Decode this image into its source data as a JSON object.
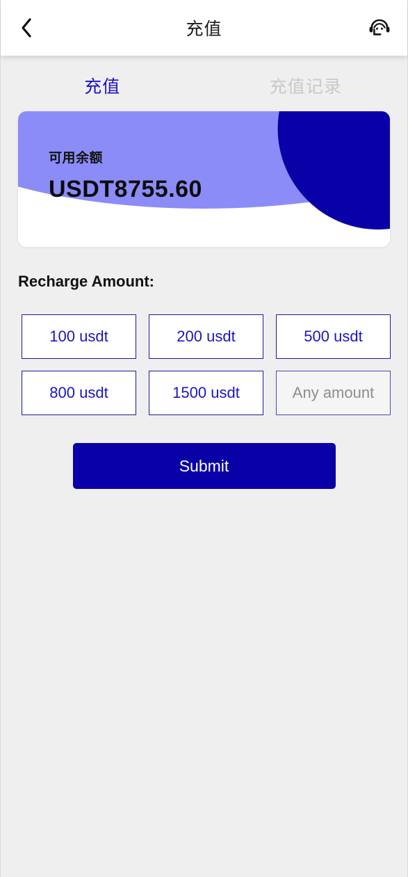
{
  "header": {
    "title": "充值",
    "back_icon": "chevron-left-icon",
    "service_icon": "headset-support-icon"
  },
  "tabs": [
    {
      "label": "充值",
      "active": true
    },
    {
      "label": "充值记录",
      "active": false
    }
  ],
  "balance_card": {
    "label": "可用余额",
    "value": "USDT8755.60",
    "colors": {
      "card_bg": "#ffffff",
      "wave_light": "#8c8cf8",
      "circle_dark": "#0a00a8"
    }
  },
  "recharge": {
    "section_title": "Recharge Amount:",
    "options": [
      {
        "label": "100 usdt"
      },
      {
        "label": "200 usdt"
      },
      {
        "label": "500 usdt"
      },
      {
        "label": "800 usdt"
      },
      {
        "label": "1500 usdt"
      }
    ],
    "custom_amount": {
      "placeholder": "Any amount",
      "value": ""
    },
    "submit_label": "Submit"
  },
  "theme": {
    "page_bg": "#efefef",
    "accent": "#0a00a8",
    "tab_active": "#1a12c8",
    "tab_inactive": "#c9c9c9",
    "option_border": "#1b1b9e",
    "option_text": "#1a14c2"
  }
}
